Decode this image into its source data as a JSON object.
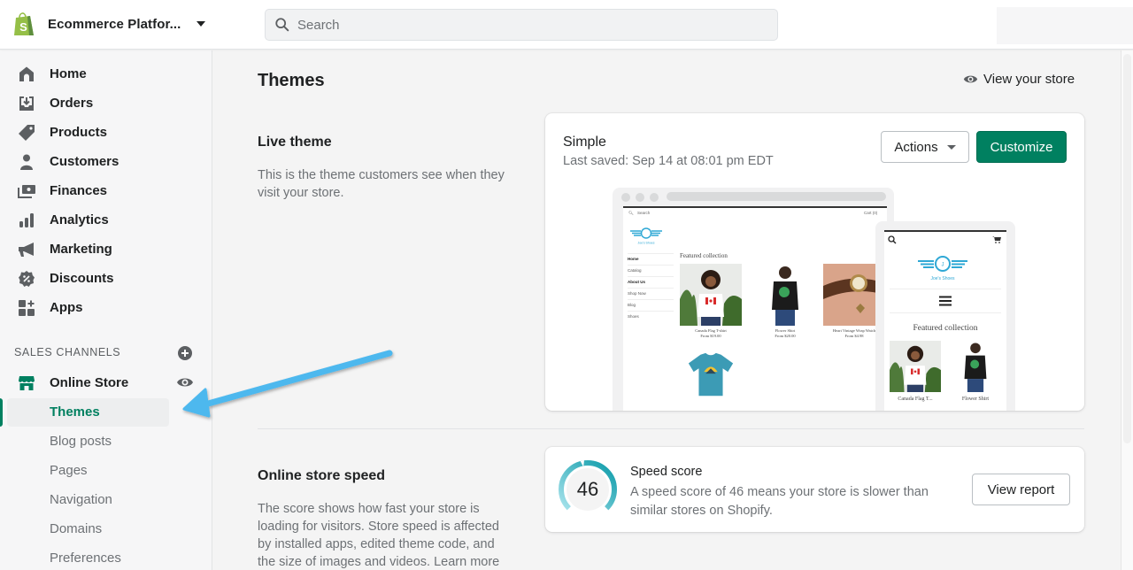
{
  "topbar": {
    "store_name": "Ecommerce Platfor...",
    "search_placeholder": "Search"
  },
  "sidebar": {
    "items": [
      {
        "label": "Home",
        "icon": "home-icon"
      },
      {
        "label": "Orders",
        "icon": "orders-icon"
      },
      {
        "label": "Products",
        "icon": "tag-icon"
      },
      {
        "label": "Customers",
        "icon": "person-icon"
      },
      {
        "label": "Finances",
        "icon": "finances-icon"
      },
      {
        "label": "Analytics",
        "icon": "bar-chart-icon"
      },
      {
        "label": "Marketing",
        "icon": "megaphone-icon"
      },
      {
        "label": "Discounts",
        "icon": "discount-icon"
      },
      {
        "label": "Apps",
        "icon": "apps-icon"
      }
    ],
    "sales_channels_label": "SALES CHANNELS",
    "online_store_label": "Online Store",
    "sub_items": [
      {
        "label": "Themes",
        "active": true
      },
      {
        "label": "Blog posts",
        "active": false
      },
      {
        "label": "Pages",
        "active": false
      },
      {
        "label": "Navigation",
        "active": false
      },
      {
        "label": "Domains",
        "active": false
      },
      {
        "label": "Preferences",
        "active": false
      }
    ]
  },
  "main": {
    "page_title": "Themes",
    "view_store_label": "View your store",
    "live_theme": {
      "title": "Live theme",
      "description": "This is the theme customers see when they visit your store.",
      "theme_name": "Simple",
      "last_saved": "Last saved: Sep 14 at 08:01 pm EDT",
      "actions_label": "Actions",
      "customize_label": "Customize",
      "preview": {
        "search": "Search",
        "cart": "Cart (0)",
        "store_logo_text": "Joe's Shoes",
        "logo_letter": "J",
        "nav": [
          "Home",
          "Catalog",
          "About Us",
          "Shop Now",
          "Blog",
          "Shoes"
        ],
        "featured_title": "Featured collection",
        "products": [
          {
            "name": "Canada Flag T-shirt",
            "price": "From $19.00"
          },
          {
            "name": "Flower Shirt",
            "price": "From $20.00"
          },
          {
            "name": "Heart Vintage Wrap Watch",
            "price": "From $4.98"
          }
        ],
        "mobile_products": [
          "Canada Flag T...",
          "Flower Shirt"
        ]
      }
    },
    "speed": {
      "title": "Online store speed",
      "description": "The score shows how fast your store is loading for visitors. Store speed is affected by installed apps, edited theme code, and the size of images and videos. Learn more",
      "score": 46,
      "score_max": 100,
      "card_title": "Speed score",
      "card_desc": "A speed score of 46 means your store is slower than similar stores on Shopify.",
      "report_label": "View report"
    }
  },
  "colors": {
    "brand_green": "#008060",
    "shopify_logo_green": "#95bf47",
    "gauge_teal": "#0a9aa8",
    "annotation_arrow": "#4db8ee"
  }
}
